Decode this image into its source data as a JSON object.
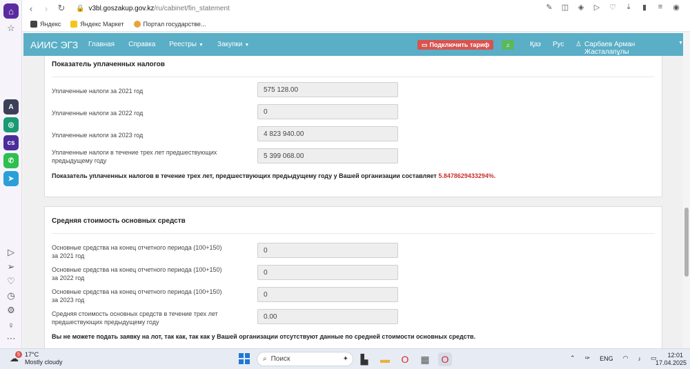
{
  "browser": {
    "url_host": "v3bl.goszakup.gov.kz",
    "url_path": "/ru/cabinet/fin_statement",
    "bookmarks": [
      "Яндекс",
      "Яндекс Маркет",
      "Портал государстве..."
    ]
  },
  "navbar": {
    "brand": "АИИС ЭГЗ",
    "links": [
      "Главная",
      "Справка",
      "Реестры",
      "Закупки"
    ],
    "tariff_button": "Подключить тариф",
    "lang_kz": "Қаз",
    "lang_ru": "Рус",
    "user": "Сарбаев Арман Жасталапұлы"
  },
  "taxes": {
    "title": "Показатель уплаченных налогов",
    "rows": [
      {
        "label": "Уплаченные налоги за 2021 год",
        "value": "575 128.00"
      },
      {
        "label": "Уплаченные налоги за 2022 год",
        "value": "0"
      },
      {
        "label": "Уплаченные налоги за 2023 год",
        "value": "4 823 940.00"
      },
      {
        "label": "Уплаченные налоги в течение трех лет предшествующих предыдущему году",
        "value": "5 399 068.00"
      }
    ],
    "summary_text": "Показатель уплаченных налогов в течение трех лет, предшествующих предыдущему году у Вашей организации составляет ",
    "summary_value": "5.8478629433294%",
    "summary_end": "."
  },
  "assets": {
    "title": "Средняя стоимость основных средств",
    "rows": [
      {
        "label": "Основные средства на конец отчетного периода (100+150) за 2021 год",
        "value": "0"
      },
      {
        "label": "Основные средства на конец отчетного периода (100+150) за 2022 год",
        "value": "0"
      },
      {
        "label": "Основные средства на конец отчетного периода (100+150) за 2023 год",
        "value": "0"
      },
      {
        "label": "Средняя стоимость основных средств в течение трех лет предшествующих предыдущему году",
        "value": "0.00"
      }
    ],
    "warning": "Вы не можете подать заявку на лот, так как, так как у Вашей организации отсутствуют данные по средней стоимости основных средств."
  },
  "taskbar": {
    "weather_badge": "5",
    "temperature": "17°C",
    "weather_desc": "Mostly cloudy",
    "search_placeholder": "Поиск",
    "language": "ENG",
    "time": "12:01",
    "date": "17.04.2025"
  },
  "colors": {
    "navbar": "#5aaec6",
    "tariff": "#d9534f",
    "bell": "#5cb85c",
    "percent": "#c9302c"
  }
}
